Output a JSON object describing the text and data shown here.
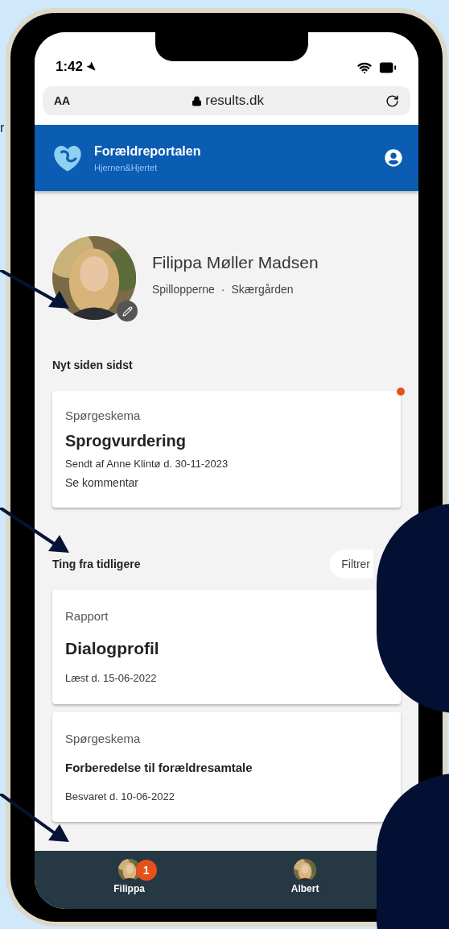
{
  "edge_text": "r",
  "status_bar": {
    "time": "1:42"
  },
  "browser": {
    "text_size_button": "AA",
    "url": "results.dk"
  },
  "app_header": {
    "title": "Forældreportalen",
    "subtitle": "Hjernen&Hjertet"
  },
  "profile": {
    "name": "Filippa Møller Madsen",
    "group": "Spillopperne",
    "separator": "·",
    "location": "Skærgården"
  },
  "sections": [
    {
      "heading": "Nyt siden sidst",
      "cards": [
        {
          "kind": "featured",
          "type": "Spørgeskema",
          "title": "Sprogvurdering",
          "detail": "Sendt af Anne Klintø d. 30-11-2023",
          "link": "Se kommentar",
          "unread": true
        }
      ]
    },
    {
      "heading": "Ting fra tidligere",
      "filter_button": "Filtrer",
      "cards": [
        {
          "kind": "large",
          "type": "Rapport",
          "title": "Dialogprofil",
          "detail": "Læst d. 15-06-2022"
        },
        {
          "kind": "compact",
          "type": "Spørgeskema",
          "title": "Forberedelse til forældresamtale",
          "detail": "Besvaret d. 10-06-2022"
        }
      ]
    }
  ],
  "bottom_nav": [
    {
      "label": "Filippa",
      "badge": "1"
    },
    {
      "label": "Albert"
    }
  ]
}
